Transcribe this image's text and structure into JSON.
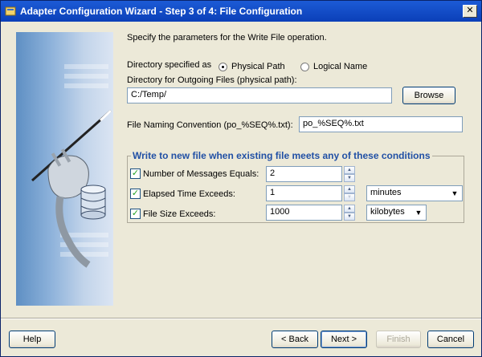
{
  "window": {
    "title": "Adapter Configuration Wizard - Step 3 of 4: File Configuration",
    "close_label": "✕"
  },
  "intro_text": "Specify the parameters for the Write File operation.",
  "directory_specified": {
    "label": "Directory specified as",
    "options": [
      {
        "label": "Physical Path",
        "selected": true
      },
      {
        "label": "Logical Name",
        "selected": false
      }
    ]
  },
  "outgoing_dir": {
    "label": "Directory for Outgoing Files (physical path):",
    "value": "C:/Temp/",
    "browse_label": "Browse"
  },
  "naming_convention": {
    "label": "File Naming Convention (po_%SEQ%.txt):",
    "value": "po_%SEQ%.txt"
  },
  "conditions": {
    "title": "Write to new file when existing file meets any of these conditions",
    "rows": [
      {
        "label": "Number of Messages Equals:",
        "checked": true,
        "value": "2"
      },
      {
        "label": "Elapsed Time Exceeds:",
        "checked": true,
        "value": "1",
        "unit": "minutes"
      },
      {
        "label": "File Size Exceeds:",
        "checked": true,
        "value": "1000",
        "unit": "kilobytes"
      }
    ]
  },
  "buttons": {
    "help": "Help",
    "back": "< Back",
    "next": "Next >",
    "finish": "Finish",
    "cancel": "Cancel"
  },
  "colors": {
    "titlebar": "#0b3fb8",
    "group_title": "#2150a5",
    "window_bg": "#ece9d8"
  },
  "icons": [
    "wizard-icon",
    "close-icon",
    "plug-illustration",
    "database-icon",
    "check-icon",
    "spin-up-icon",
    "spin-down-icon",
    "dropdown-arrow-icon"
  ]
}
